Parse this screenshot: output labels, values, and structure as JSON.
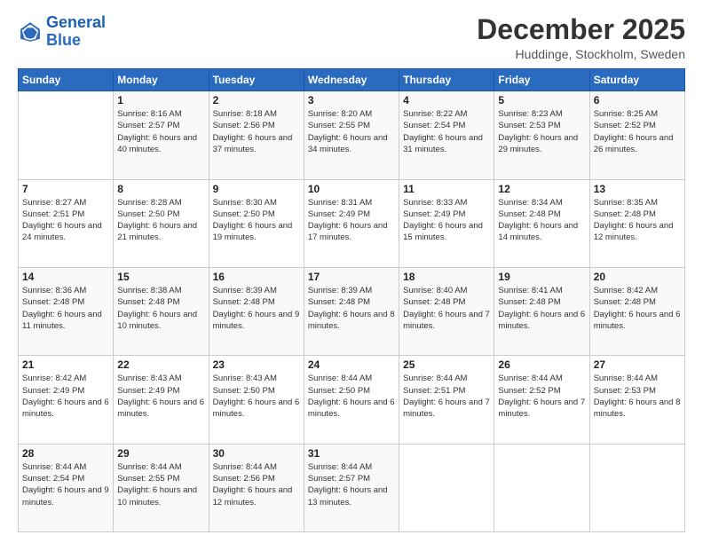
{
  "logo": {
    "line1": "General",
    "line2": "Blue"
  },
  "title": "December 2025",
  "subtitle": "Huddinge, Stockholm, Sweden",
  "weekdays": [
    "Sunday",
    "Monday",
    "Tuesday",
    "Wednesday",
    "Thursday",
    "Friday",
    "Saturday"
  ],
  "weeks": [
    [
      {
        "day": "",
        "sunrise": "",
        "sunset": "",
        "daylight": ""
      },
      {
        "day": "1",
        "sunrise": "Sunrise: 8:16 AM",
        "sunset": "Sunset: 2:57 PM",
        "daylight": "Daylight: 6 hours and 40 minutes."
      },
      {
        "day": "2",
        "sunrise": "Sunrise: 8:18 AM",
        "sunset": "Sunset: 2:56 PM",
        "daylight": "Daylight: 6 hours and 37 minutes."
      },
      {
        "day": "3",
        "sunrise": "Sunrise: 8:20 AM",
        "sunset": "Sunset: 2:55 PM",
        "daylight": "Daylight: 6 hours and 34 minutes."
      },
      {
        "day": "4",
        "sunrise": "Sunrise: 8:22 AM",
        "sunset": "Sunset: 2:54 PM",
        "daylight": "Daylight: 6 hours and 31 minutes."
      },
      {
        "day": "5",
        "sunrise": "Sunrise: 8:23 AM",
        "sunset": "Sunset: 2:53 PM",
        "daylight": "Daylight: 6 hours and 29 minutes."
      },
      {
        "day": "6",
        "sunrise": "Sunrise: 8:25 AM",
        "sunset": "Sunset: 2:52 PM",
        "daylight": "Daylight: 6 hours and 26 minutes."
      }
    ],
    [
      {
        "day": "7",
        "sunrise": "Sunrise: 8:27 AM",
        "sunset": "Sunset: 2:51 PM",
        "daylight": "Daylight: 6 hours and 24 minutes."
      },
      {
        "day": "8",
        "sunrise": "Sunrise: 8:28 AM",
        "sunset": "Sunset: 2:50 PM",
        "daylight": "Daylight: 6 hours and 21 minutes."
      },
      {
        "day": "9",
        "sunrise": "Sunrise: 8:30 AM",
        "sunset": "Sunset: 2:50 PM",
        "daylight": "Daylight: 6 hours and 19 minutes."
      },
      {
        "day": "10",
        "sunrise": "Sunrise: 8:31 AM",
        "sunset": "Sunset: 2:49 PM",
        "daylight": "Daylight: 6 hours and 17 minutes."
      },
      {
        "day": "11",
        "sunrise": "Sunrise: 8:33 AM",
        "sunset": "Sunset: 2:49 PM",
        "daylight": "Daylight: 6 hours and 15 minutes."
      },
      {
        "day": "12",
        "sunrise": "Sunrise: 8:34 AM",
        "sunset": "Sunset: 2:48 PM",
        "daylight": "Daylight: 6 hours and 14 minutes."
      },
      {
        "day": "13",
        "sunrise": "Sunrise: 8:35 AM",
        "sunset": "Sunset: 2:48 PM",
        "daylight": "Daylight: 6 hours and 12 minutes."
      }
    ],
    [
      {
        "day": "14",
        "sunrise": "Sunrise: 8:36 AM",
        "sunset": "Sunset: 2:48 PM",
        "daylight": "Daylight: 6 hours and 11 minutes."
      },
      {
        "day": "15",
        "sunrise": "Sunrise: 8:38 AM",
        "sunset": "Sunset: 2:48 PM",
        "daylight": "Daylight: 6 hours and 10 minutes."
      },
      {
        "day": "16",
        "sunrise": "Sunrise: 8:39 AM",
        "sunset": "Sunset: 2:48 PM",
        "daylight": "Daylight: 6 hours and 9 minutes."
      },
      {
        "day": "17",
        "sunrise": "Sunrise: 8:39 AM",
        "sunset": "Sunset: 2:48 PM",
        "daylight": "Daylight: 6 hours and 8 minutes."
      },
      {
        "day": "18",
        "sunrise": "Sunrise: 8:40 AM",
        "sunset": "Sunset: 2:48 PM",
        "daylight": "Daylight: 6 hours and 7 minutes."
      },
      {
        "day": "19",
        "sunrise": "Sunrise: 8:41 AM",
        "sunset": "Sunset: 2:48 PM",
        "daylight": "Daylight: 6 hours and 6 minutes."
      },
      {
        "day": "20",
        "sunrise": "Sunrise: 8:42 AM",
        "sunset": "Sunset: 2:48 PM",
        "daylight": "Daylight: 6 hours and 6 minutes."
      }
    ],
    [
      {
        "day": "21",
        "sunrise": "Sunrise: 8:42 AM",
        "sunset": "Sunset: 2:49 PM",
        "daylight": "Daylight: 6 hours and 6 minutes."
      },
      {
        "day": "22",
        "sunrise": "Sunrise: 8:43 AM",
        "sunset": "Sunset: 2:49 PM",
        "daylight": "Daylight: 6 hours and 6 minutes."
      },
      {
        "day": "23",
        "sunrise": "Sunrise: 8:43 AM",
        "sunset": "Sunset: 2:50 PM",
        "daylight": "Daylight: 6 hours and 6 minutes."
      },
      {
        "day": "24",
        "sunrise": "Sunrise: 8:44 AM",
        "sunset": "Sunset: 2:50 PM",
        "daylight": "Daylight: 6 hours and 6 minutes."
      },
      {
        "day": "25",
        "sunrise": "Sunrise: 8:44 AM",
        "sunset": "Sunset: 2:51 PM",
        "daylight": "Daylight: 6 hours and 7 minutes."
      },
      {
        "day": "26",
        "sunrise": "Sunrise: 8:44 AM",
        "sunset": "Sunset: 2:52 PM",
        "daylight": "Daylight: 6 hours and 7 minutes."
      },
      {
        "day": "27",
        "sunrise": "Sunrise: 8:44 AM",
        "sunset": "Sunset: 2:53 PM",
        "daylight": "Daylight: 6 hours and 8 minutes."
      }
    ],
    [
      {
        "day": "28",
        "sunrise": "Sunrise: 8:44 AM",
        "sunset": "Sunset: 2:54 PM",
        "daylight": "Daylight: 6 hours and 9 minutes."
      },
      {
        "day": "29",
        "sunrise": "Sunrise: 8:44 AM",
        "sunset": "Sunset: 2:55 PM",
        "daylight": "Daylight: 6 hours and 10 minutes."
      },
      {
        "day": "30",
        "sunrise": "Sunrise: 8:44 AM",
        "sunset": "Sunset: 2:56 PM",
        "daylight": "Daylight: 6 hours and 12 minutes."
      },
      {
        "day": "31",
        "sunrise": "Sunrise: 8:44 AM",
        "sunset": "Sunset: 2:57 PM",
        "daylight": "Daylight: 6 hours and 13 minutes."
      },
      {
        "day": "",
        "sunrise": "",
        "sunset": "",
        "daylight": ""
      },
      {
        "day": "",
        "sunrise": "",
        "sunset": "",
        "daylight": ""
      },
      {
        "day": "",
        "sunrise": "",
        "sunset": "",
        "daylight": ""
      }
    ]
  ]
}
